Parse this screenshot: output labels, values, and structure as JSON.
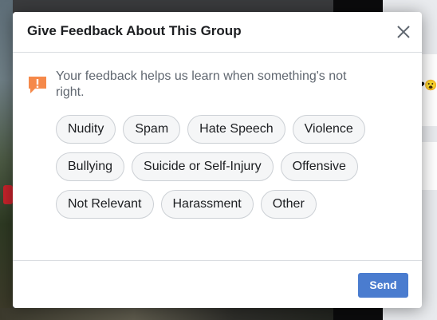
{
  "dialog": {
    "title": "Give Feedback About This Group",
    "close_icon": "close-icon",
    "info_icon": "exclamation-icon",
    "info_text": "Your feedback helps us learn when something's not right.",
    "chips": [
      [
        "Nudity",
        "Spam",
        "Hate Speech",
        "Violence"
      ],
      [
        "Bullying",
        "Suicide or Self-Injury",
        "Offensive"
      ],
      [
        "Not Relevant",
        "Harassment",
        "Other"
      ]
    ],
    "send_label": "Send"
  },
  "colors": {
    "accent": "#4a7ccf",
    "info_icon": "#f5894a",
    "chip_bg": "#f5f6f7"
  }
}
